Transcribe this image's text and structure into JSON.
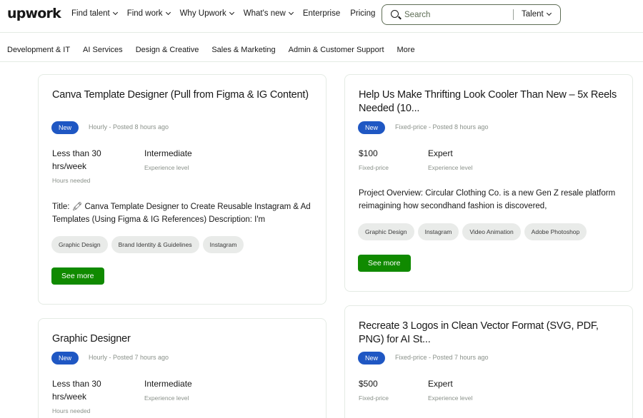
{
  "header": {
    "logo": "upwork",
    "nav": [
      "Find talent",
      "Find work",
      "Why Upwork",
      "What's new",
      "Enterprise",
      "Pricing"
    ],
    "nav_has_dropdown": [
      true,
      true,
      true,
      true,
      false,
      false
    ],
    "search": {
      "placeholder": "Search",
      "scope": "Talent"
    }
  },
  "categories": [
    "Development & IT",
    "AI Services",
    "Design & Creative",
    "Sales & Marketing",
    "Admin & Customer Support",
    "More"
  ],
  "jobs": [
    {
      "title": "Canva Template Designer (Pull from Figma & IG Content)",
      "badge": "New",
      "meta": "Hourly - Posted 8 hours ago",
      "stat1_value": "Less than 30 hrs/week",
      "stat1_label": "Hours needed",
      "stat2_value": "Intermediate",
      "stat2_label": "Experience level",
      "description": "Title: 🖍 Canva Template Designer to Create Reusable Instagram & Ad Templates (Using Figma & IG References) Description: I'm",
      "skills": [
        "Graphic Design",
        "Brand Identity & Guidelines",
        "Instagram"
      ],
      "cta": "See more"
    },
    {
      "title": "Help Us Make Thrifting Look Cooler Than New – 5x Reels Needed (10...",
      "badge": "New",
      "meta": "Fixed-price - Posted 8 hours ago",
      "stat1_value": "$100",
      "stat1_label": "Fixed-price",
      "stat2_value": "Expert",
      "stat2_label": "Experience level",
      "description": "Project Overview: Circular Clothing Co. is a new Gen Z resale platform reimagining how secondhand fashion is discovered,",
      "skills": [
        "Graphic Design",
        "Instagram",
        "Video Animation",
        "Adobe Photoshop"
      ],
      "cta": "See more"
    },
    {
      "title": "Graphic Designer",
      "badge": "New",
      "meta": "Hourly - Posted 7 hours ago",
      "stat1_value": "Less than 30 hrs/week",
      "stat1_label": "Hours needed",
      "stat2_value": "Intermediate",
      "stat2_label": "Experience level"
    },
    {
      "title": "Recreate 3 Logos in Clean Vector Format (SVG, PDF, PNG) for AI St...",
      "badge": "New",
      "meta": "Fixed-price - Posted 7 hours ago",
      "stat1_value": "$500",
      "stat1_label": "Fixed-price",
      "stat2_value": "Expert",
      "stat2_label": "Experience level"
    }
  ]
}
